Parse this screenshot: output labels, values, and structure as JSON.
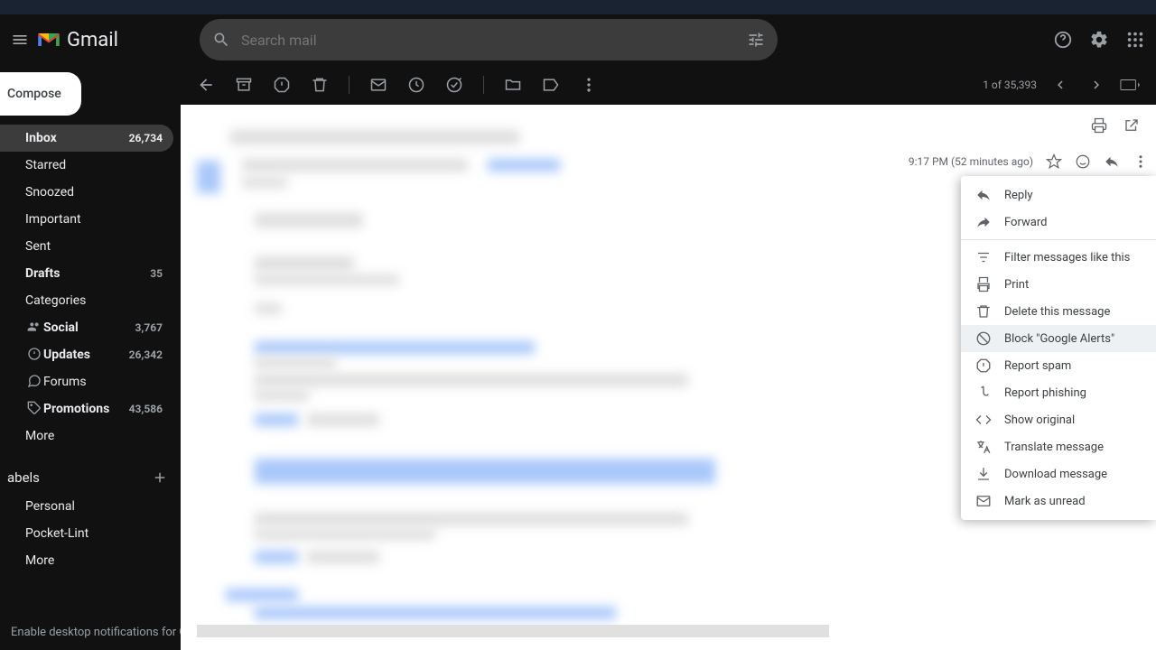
{
  "app": {
    "name": "Gmail"
  },
  "search": {
    "placeholder": "Search mail"
  },
  "compose": {
    "label": "Compose"
  },
  "sidebar": {
    "items": [
      {
        "label": "Inbox",
        "count": "26,734",
        "active": true,
        "bold": true
      },
      {
        "label": "Starred"
      },
      {
        "label": "Snoozed"
      },
      {
        "label": "Important"
      },
      {
        "label": "Sent"
      },
      {
        "label": "Drafts",
        "count": "35",
        "bold": true
      },
      {
        "label": "Categories"
      }
    ],
    "categories": [
      {
        "label": "Social",
        "count": "3,767",
        "bold": true
      },
      {
        "label": "Updates",
        "count": "26,342",
        "bold": true
      },
      {
        "label": "Forums"
      },
      {
        "label": "Promotions",
        "count": "43,586",
        "bold": true
      }
    ],
    "more": "More",
    "labels_header": "abels",
    "labels": [
      {
        "label": "Personal"
      },
      {
        "label": "Pocket-Lint"
      }
    ],
    "labels_more": "More"
  },
  "toolbar": {
    "pagination": "1 of 35,393"
  },
  "message": {
    "timestamp": "9:17 PM (52 minutes ago)"
  },
  "context_menu": {
    "reply": "Reply",
    "forward": "Forward",
    "filter": "Filter messages like this",
    "print": "Print",
    "delete": "Delete this message",
    "block": "Block \"Google Alerts\"",
    "spam": "Report spam",
    "phishing": "Report phishing",
    "original": "Show original",
    "translate": "Translate message",
    "download": "Download message",
    "unread": "Mark as unread"
  },
  "notification": "Enable desktop notifications for Gma"
}
